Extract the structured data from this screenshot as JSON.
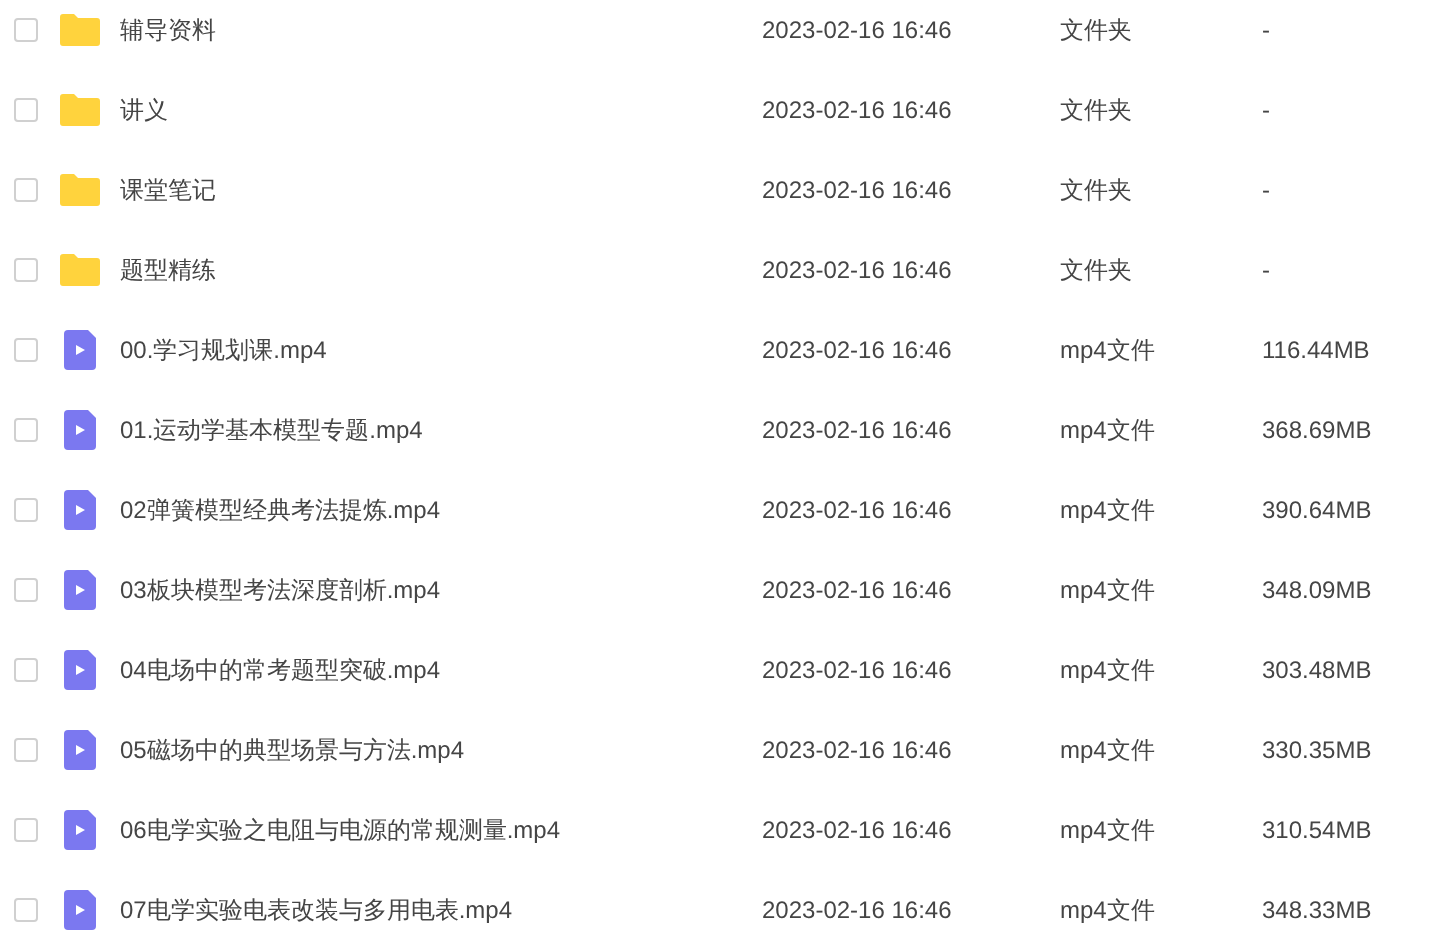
{
  "files": [
    {
      "kind": "folder",
      "name": "辅导资料",
      "modified": "2023-02-16 16:46",
      "type": "文件夹",
      "size": "-",
      "checked": false
    },
    {
      "kind": "folder",
      "name": "讲义",
      "modified": "2023-02-16 16:46",
      "type": "文件夹",
      "size": "-",
      "checked": false
    },
    {
      "kind": "folder",
      "name": "课堂笔记",
      "modified": "2023-02-16 16:46",
      "type": "文件夹",
      "size": "-",
      "checked": false
    },
    {
      "kind": "folder",
      "name": "题型精练",
      "modified": "2023-02-16 16:46",
      "type": "文件夹",
      "size": "-",
      "checked": false
    },
    {
      "kind": "video",
      "name": "00.学习规划课.mp4",
      "modified": "2023-02-16 16:46",
      "type": "mp4文件",
      "size": "116.44MB",
      "checked": false
    },
    {
      "kind": "video",
      "name": "01.运动学基本模型专题.mp4",
      "modified": "2023-02-16 16:46",
      "type": "mp4文件",
      "size": "368.69MB",
      "checked": false
    },
    {
      "kind": "video",
      "name": "02弹簧模型经典考法提炼.mp4",
      "modified": "2023-02-16 16:46",
      "type": "mp4文件",
      "size": "390.64MB",
      "checked": false
    },
    {
      "kind": "video",
      "name": "03板块模型考法深度剖析.mp4",
      "modified": "2023-02-16 16:46",
      "type": "mp4文件",
      "size": "348.09MB",
      "checked": false
    },
    {
      "kind": "video",
      "name": "04电场中的常考题型突破.mp4",
      "modified": "2023-02-16 16:46",
      "type": "mp4文件",
      "size": "303.48MB",
      "checked": false
    },
    {
      "kind": "video",
      "name": "05磁场中的典型场景与方法.mp4",
      "modified": "2023-02-16 16:46",
      "type": "mp4文件",
      "size": "330.35MB",
      "checked": false
    },
    {
      "kind": "video",
      "name": "06电学实验之电阻与电源的常规测量.mp4",
      "modified": "2023-02-16 16:46",
      "type": "mp4文件",
      "size": "310.54MB",
      "checked": false
    },
    {
      "kind": "video",
      "name": "07电学实验电表改装与多用电表.mp4",
      "modified": "2023-02-16 16:46",
      "type": "mp4文件",
      "size": "348.33MB",
      "checked": false
    }
  ]
}
